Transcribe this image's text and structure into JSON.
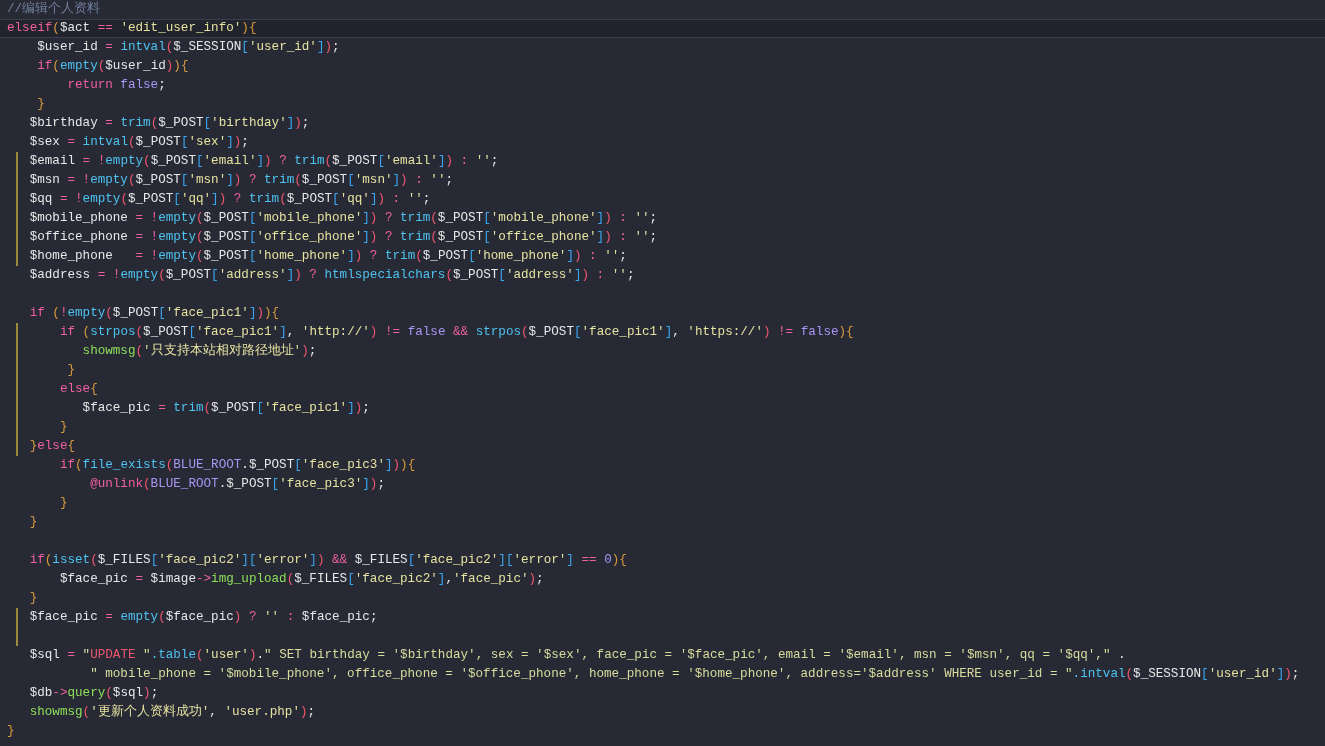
{
  "editor": {
    "lines": [
      {
        "kind": "code",
        "tokens": [
          {
            "kind": "comment",
            "text": "//编辑个人资料"
          }
        ]
      },
      {
        "kind": "code",
        "current": true,
        "tokens": [
          {
            "kind": "keyword",
            "text": "elseif"
          },
          {
            "kind": "brace",
            "text": "("
          },
          {
            "kind": "variable",
            "text": "$act"
          },
          {
            "kind": "operator",
            "text": " == "
          },
          {
            "kind": "string",
            "text": "'edit_user_info'"
          },
          {
            "kind": "brace",
            "text": ")"
          },
          {
            "kind": "brace",
            "text": "{"
          }
        ]
      },
      {
        "kind": "code",
        "tokens": [
          {
            "kind": "variable",
            "text": "    $user_id"
          },
          {
            "kind": "operator",
            "text": " = "
          },
          {
            "kind": "function",
            "text": "intval"
          },
          {
            "kind": "paren",
            "text": "("
          },
          {
            "kind": "variable",
            "text": "$_SESSION"
          },
          {
            "kind": "bracket",
            "text": "["
          },
          {
            "kind": "string",
            "text": "'user_id'"
          },
          {
            "kind": "bracket",
            "text": "]"
          },
          {
            "kind": "paren",
            "text": ")"
          },
          {
            "kind": "plain",
            "text": ";"
          }
        ]
      },
      {
        "kind": "code",
        "tokens": [
          {
            "kind": "keyword",
            "text": "    if"
          },
          {
            "kind": "brace",
            "text": "("
          },
          {
            "kind": "function",
            "text": "empty"
          },
          {
            "kind": "paren",
            "text": "("
          },
          {
            "kind": "variable",
            "text": "$user_id"
          },
          {
            "kind": "paren",
            "text": ")"
          },
          {
            "kind": "brace",
            "text": ")"
          },
          {
            "kind": "brace",
            "text": "{"
          }
        ]
      },
      {
        "kind": "code",
        "tokens": [
          {
            "kind": "keyword",
            "text": "        return"
          },
          {
            "kind": "constant",
            "text": " false"
          },
          {
            "kind": "plain",
            "text": ";"
          }
        ]
      },
      {
        "kind": "code",
        "tokens": [
          {
            "kind": "brace",
            "text": "    }"
          }
        ]
      },
      {
        "kind": "code",
        "tokens": [
          {
            "kind": "variable",
            "text": "   $birthday"
          },
          {
            "kind": "operator",
            "text": " = "
          },
          {
            "kind": "function",
            "text": "trim"
          },
          {
            "kind": "paren",
            "text": "("
          },
          {
            "kind": "variable",
            "text": "$_POST"
          },
          {
            "kind": "bracket",
            "text": "["
          },
          {
            "kind": "string",
            "text": "'birthday'"
          },
          {
            "kind": "bracket",
            "text": "]"
          },
          {
            "kind": "paren",
            "text": ")"
          },
          {
            "kind": "plain",
            "text": ";"
          }
        ]
      },
      {
        "kind": "code",
        "tokens": [
          {
            "kind": "variable",
            "text": "   $sex"
          },
          {
            "kind": "operator",
            "text": " = "
          },
          {
            "kind": "function",
            "text": "intval"
          },
          {
            "kind": "paren",
            "text": "("
          },
          {
            "kind": "variable",
            "text": "$_POST"
          },
          {
            "kind": "bracket",
            "text": "["
          },
          {
            "kind": "string",
            "text": "'sex'"
          },
          {
            "kind": "bracket",
            "text": "]"
          },
          {
            "kind": "paren",
            "text": ")"
          },
          {
            "kind": "plain",
            "text": ";"
          }
        ]
      },
      {
        "kind": "code",
        "modified": true,
        "tokens": [
          {
            "kind": "variable",
            "text": "   $email"
          },
          {
            "kind": "operator",
            "text": " = !"
          },
          {
            "kind": "function",
            "text": "empty"
          },
          {
            "kind": "paren",
            "text": "("
          },
          {
            "kind": "variable",
            "text": "$_POST"
          },
          {
            "kind": "bracket",
            "text": "["
          },
          {
            "kind": "string",
            "text": "'email'"
          },
          {
            "kind": "bracket",
            "text": "]"
          },
          {
            "kind": "paren",
            "text": ")"
          },
          {
            "kind": "operator",
            "text": " ? "
          },
          {
            "kind": "function",
            "text": "trim"
          },
          {
            "kind": "paren",
            "text": "("
          },
          {
            "kind": "variable",
            "text": "$_POST"
          },
          {
            "kind": "bracket",
            "text": "["
          },
          {
            "kind": "string",
            "text": "'email'"
          },
          {
            "kind": "bracket",
            "text": "]"
          },
          {
            "kind": "paren",
            "text": ")"
          },
          {
            "kind": "operator",
            "text": " : "
          },
          {
            "kind": "string",
            "text": "''"
          },
          {
            "kind": "plain",
            "text": ";"
          }
        ]
      },
      {
        "kind": "code",
        "modified": true,
        "tokens": [
          {
            "kind": "variable",
            "text": "   $msn"
          },
          {
            "kind": "operator",
            "text": " = !"
          },
          {
            "kind": "function",
            "text": "empty"
          },
          {
            "kind": "paren",
            "text": "("
          },
          {
            "kind": "variable",
            "text": "$_POST"
          },
          {
            "kind": "bracket",
            "text": "["
          },
          {
            "kind": "string",
            "text": "'msn'"
          },
          {
            "kind": "bracket",
            "text": "]"
          },
          {
            "kind": "paren",
            "text": ")"
          },
          {
            "kind": "operator",
            "text": " ? "
          },
          {
            "kind": "function",
            "text": "trim"
          },
          {
            "kind": "paren",
            "text": "("
          },
          {
            "kind": "variable",
            "text": "$_POST"
          },
          {
            "kind": "bracket",
            "text": "["
          },
          {
            "kind": "string",
            "text": "'msn'"
          },
          {
            "kind": "bracket",
            "text": "]"
          },
          {
            "kind": "paren",
            "text": ")"
          },
          {
            "kind": "operator",
            "text": " : "
          },
          {
            "kind": "string",
            "text": "''"
          },
          {
            "kind": "plain",
            "text": ";"
          }
        ]
      },
      {
        "kind": "code",
        "modified": true,
        "tokens": [
          {
            "kind": "variable",
            "text": "   $qq"
          },
          {
            "kind": "operator",
            "text": " = !"
          },
          {
            "kind": "function",
            "text": "empty"
          },
          {
            "kind": "paren",
            "text": "("
          },
          {
            "kind": "variable",
            "text": "$_POST"
          },
          {
            "kind": "bracket",
            "text": "["
          },
          {
            "kind": "string",
            "text": "'qq'"
          },
          {
            "kind": "bracket",
            "text": "]"
          },
          {
            "kind": "paren",
            "text": ")"
          },
          {
            "kind": "operator",
            "text": " ? "
          },
          {
            "kind": "function",
            "text": "trim"
          },
          {
            "kind": "paren",
            "text": "("
          },
          {
            "kind": "variable",
            "text": "$_POST"
          },
          {
            "kind": "bracket",
            "text": "["
          },
          {
            "kind": "string",
            "text": "'qq'"
          },
          {
            "kind": "bracket",
            "text": "]"
          },
          {
            "kind": "paren",
            "text": ")"
          },
          {
            "kind": "operator",
            "text": " : "
          },
          {
            "kind": "string",
            "text": "''"
          },
          {
            "kind": "plain",
            "text": ";"
          }
        ]
      },
      {
        "kind": "code",
        "modified": true,
        "tokens": [
          {
            "kind": "variable",
            "text": "   $mobile_phone"
          },
          {
            "kind": "operator",
            "text": " = !"
          },
          {
            "kind": "function",
            "text": "empty"
          },
          {
            "kind": "paren",
            "text": "("
          },
          {
            "kind": "variable",
            "text": "$_POST"
          },
          {
            "kind": "bracket",
            "text": "["
          },
          {
            "kind": "string",
            "text": "'mobile_phone'"
          },
          {
            "kind": "bracket",
            "text": "]"
          },
          {
            "kind": "paren",
            "text": ")"
          },
          {
            "kind": "operator",
            "text": " ? "
          },
          {
            "kind": "function",
            "text": "trim"
          },
          {
            "kind": "paren",
            "text": "("
          },
          {
            "kind": "variable",
            "text": "$_POST"
          },
          {
            "kind": "bracket",
            "text": "["
          },
          {
            "kind": "string",
            "text": "'mobile_phone'"
          },
          {
            "kind": "bracket",
            "text": "]"
          },
          {
            "kind": "paren",
            "text": ")"
          },
          {
            "kind": "operator",
            "text": " : "
          },
          {
            "kind": "string",
            "text": "''"
          },
          {
            "kind": "plain",
            "text": ";"
          }
        ]
      },
      {
        "kind": "code",
        "modified": true,
        "tokens": [
          {
            "kind": "variable",
            "text": "   $office_phone"
          },
          {
            "kind": "operator",
            "text": " = !"
          },
          {
            "kind": "function",
            "text": "empty"
          },
          {
            "kind": "paren",
            "text": "("
          },
          {
            "kind": "variable",
            "text": "$_POST"
          },
          {
            "kind": "bracket",
            "text": "["
          },
          {
            "kind": "string",
            "text": "'office_phone'"
          },
          {
            "kind": "bracket",
            "text": "]"
          },
          {
            "kind": "paren",
            "text": ")"
          },
          {
            "kind": "operator",
            "text": " ? "
          },
          {
            "kind": "function",
            "text": "trim"
          },
          {
            "kind": "paren",
            "text": "("
          },
          {
            "kind": "variable",
            "text": "$_POST"
          },
          {
            "kind": "bracket",
            "text": "["
          },
          {
            "kind": "string",
            "text": "'office_phone'"
          },
          {
            "kind": "bracket",
            "text": "]"
          },
          {
            "kind": "paren",
            "text": ")"
          },
          {
            "kind": "operator",
            "text": " : "
          },
          {
            "kind": "string",
            "text": "''"
          },
          {
            "kind": "plain",
            "text": ";"
          }
        ]
      },
      {
        "kind": "code",
        "modified": true,
        "tokens": [
          {
            "kind": "variable",
            "text": "   $home_phone"
          },
          {
            "kind": "operator",
            "text": "   = !"
          },
          {
            "kind": "function",
            "text": "empty"
          },
          {
            "kind": "paren",
            "text": "("
          },
          {
            "kind": "variable",
            "text": "$_POST"
          },
          {
            "kind": "bracket",
            "text": "["
          },
          {
            "kind": "string",
            "text": "'home_phone'"
          },
          {
            "kind": "bracket",
            "text": "]"
          },
          {
            "kind": "paren",
            "text": ")"
          },
          {
            "kind": "operator",
            "text": " ? "
          },
          {
            "kind": "function",
            "text": "trim"
          },
          {
            "kind": "paren",
            "text": "("
          },
          {
            "kind": "variable",
            "text": "$_POST"
          },
          {
            "kind": "bracket",
            "text": "["
          },
          {
            "kind": "string",
            "text": "'home_phone'"
          },
          {
            "kind": "bracket",
            "text": "]"
          },
          {
            "kind": "paren",
            "text": ")"
          },
          {
            "kind": "operator",
            "text": " : "
          },
          {
            "kind": "string",
            "text": "''"
          },
          {
            "kind": "plain",
            "text": ";"
          }
        ]
      },
      {
        "kind": "code",
        "tokens": [
          {
            "kind": "variable",
            "text": "   $address"
          },
          {
            "kind": "operator",
            "text": " = !"
          },
          {
            "kind": "function",
            "text": "empty"
          },
          {
            "kind": "paren",
            "text": "("
          },
          {
            "kind": "variable",
            "text": "$_POST"
          },
          {
            "kind": "bracket",
            "text": "["
          },
          {
            "kind": "string",
            "text": "'address'"
          },
          {
            "kind": "bracket",
            "text": "]"
          },
          {
            "kind": "paren",
            "text": ")"
          },
          {
            "kind": "operator",
            "text": " ? "
          },
          {
            "kind": "function",
            "text": "htmlspecialchars"
          },
          {
            "kind": "paren",
            "text": "("
          },
          {
            "kind": "variable",
            "text": "$_POST"
          },
          {
            "kind": "bracket",
            "text": "["
          },
          {
            "kind": "string",
            "text": "'address'"
          },
          {
            "kind": "bracket",
            "text": "]"
          },
          {
            "kind": "paren",
            "text": ")"
          },
          {
            "kind": "operator",
            "text": " : "
          },
          {
            "kind": "string",
            "text": "''"
          },
          {
            "kind": "plain",
            "text": ";"
          }
        ]
      },
      {
        "kind": "blank"
      },
      {
        "kind": "code",
        "tokens": [
          {
            "kind": "keyword",
            "text": "   if"
          },
          {
            "kind": "brace",
            "text": " ("
          },
          {
            "kind": "operator",
            "text": "!"
          },
          {
            "kind": "function",
            "text": "empty"
          },
          {
            "kind": "paren",
            "text": "("
          },
          {
            "kind": "variable",
            "text": "$_POST"
          },
          {
            "kind": "bracket",
            "text": "["
          },
          {
            "kind": "string",
            "text": "'face_pic1'"
          },
          {
            "kind": "bracket",
            "text": "]"
          },
          {
            "kind": "paren",
            "text": ")"
          },
          {
            "kind": "brace",
            "text": ")"
          },
          {
            "kind": "brace",
            "text": "{"
          }
        ]
      },
      {
        "kind": "code",
        "modified": true,
        "tokens": [
          {
            "kind": "keyword",
            "text": "       if"
          },
          {
            "kind": "brace",
            "text": " ("
          },
          {
            "kind": "function",
            "text": "strpos"
          },
          {
            "kind": "paren",
            "text": "("
          },
          {
            "kind": "variable",
            "text": "$_POST"
          },
          {
            "kind": "bracket",
            "text": "["
          },
          {
            "kind": "string",
            "text": "'face_pic1'"
          },
          {
            "kind": "bracket",
            "text": "]"
          },
          {
            "kind": "plain",
            "text": ", "
          },
          {
            "kind": "string",
            "text": "'http://'"
          },
          {
            "kind": "paren",
            "text": ")"
          },
          {
            "kind": "operator",
            "text": " != "
          },
          {
            "kind": "constant",
            "text": "false"
          },
          {
            "kind": "operator",
            "text": " && "
          },
          {
            "kind": "function",
            "text": "strpos"
          },
          {
            "kind": "paren",
            "text": "("
          },
          {
            "kind": "variable",
            "text": "$_POST"
          },
          {
            "kind": "bracket",
            "text": "["
          },
          {
            "kind": "string",
            "text": "'face_pic1'"
          },
          {
            "kind": "bracket",
            "text": "]"
          },
          {
            "kind": "plain",
            "text": ", "
          },
          {
            "kind": "string",
            "text": "'https://'"
          },
          {
            "kind": "paren",
            "text": ")"
          },
          {
            "kind": "operator",
            "text": " != "
          },
          {
            "kind": "constant",
            "text": "false"
          },
          {
            "kind": "brace",
            "text": ")"
          },
          {
            "kind": "brace",
            "text": "{"
          }
        ]
      },
      {
        "kind": "code",
        "modified": true,
        "tokens": [
          {
            "kind": "method",
            "text": "          showmsg"
          },
          {
            "kind": "paren",
            "text": "("
          },
          {
            "kind": "string",
            "text": "'只支持本站相对路径地址'"
          },
          {
            "kind": "paren",
            "text": ")"
          },
          {
            "kind": "plain",
            "text": ";"
          }
        ]
      },
      {
        "kind": "code",
        "modified": true,
        "tokens": [
          {
            "kind": "brace",
            "text": "        }"
          }
        ]
      },
      {
        "kind": "code",
        "modified": true,
        "tokens": [
          {
            "kind": "keyword",
            "text": "       else"
          },
          {
            "kind": "brace",
            "text": "{"
          }
        ]
      },
      {
        "kind": "code",
        "modified": true,
        "tokens": [
          {
            "kind": "variable",
            "text": "          $face_pic"
          },
          {
            "kind": "operator",
            "text": " = "
          },
          {
            "kind": "function",
            "text": "trim"
          },
          {
            "kind": "paren",
            "text": "("
          },
          {
            "kind": "variable",
            "text": "$_POST"
          },
          {
            "kind": "bracket",
            "text": "["
          },
          {
            "kind": "string",
            "text": "'face_pic1'"
          },
          {
            "kind": "bracket",
            "text": "]"
          },
          {
            "kind": "paren",
            "text": ")"
          },
          {
            "kind": "plain",
            "text": ";"
          }
        ]
      },
      {
        "kind": "code",
        "modified": true,
        "tokens": [
          {
            "kind": "brace",
            "text": "       }"
          }
        ]
      },
      {
        "kind": "code",
        "modified": true,
        "tokens": [
          {
            "kind": "brace",
            "text": "   }"
          },
          {
            "kind": "keyword",
            "text": "else"
          },
          {
            "kind": "brace",
            "text": "{"
          }
        ]
      },
      {
        "kind": "code",
        "tokens": [
          {
            "kind": "keyword",
            "text": "       if"
          },
          {
            "kind": "brace",
            "text": "("
          },
          {
            "kind": "function",
            "text": "file_exists"
          },
          {
            "kind": "paren",
            "text": "("
          },
          {
            "kind": "constant",
            "text": "BLUE_ROOT"
          },
          {
            "kind": "plain",
            "text": "."
          },
          {
            "kind": "variable",
            "text": "$_POST"
          },
          {
            "kind": "bracket",
            "text": "["
          },
          {
            "kind": "string",
            "text": "'face_pic3'"
          },
          {
            "kind": "bracket",
            "text": "]"
          },
          {
            "kind": "paren",
            "text": ")"
          },
          {
            "kind": "brace",
            "text": ")"
          },
          {
            "kind": "brace",
            "text": "{"
          }
        ]
      },
      {
        "kind": "code",
        "tokens": [
          {
            "kind": "keyword",
            "text": "           @unlink"
          },
          {
            "kind": "paren",
            "text": "("
          },
          {
            "kind": "constant",
            "text": "BLUE_ROOT"
          },
          {
            "kind": "plain",
            "text": "."
          },
          {
            "kind": "variable",
            "text": "$_POST"
          },
          {
            "kind": "bracket",
            "text": "["
          },
          {
            "kind": "string",
            "text": "'face_pic3'"
          },
          {
            "kind": "bracket",
            "text": "]"
          },
          {
            "kind": "paren",
            "text": ")"
          },
          {
            "kind": "plain",
            "text": ";"
          }
        ]
      },
      {
        "kind": "code",
        "tokens": [
          {
            "kind": "brace",
            "text": "       }"
          }
        ]
      },
      {
        "kind": "code",
        "tokens": [
          {
            "kind": "brace",
            "text": "   }"
          }
        ]
      },
      {
        "kind": "blank"
      },
      {
        "kind": "code",
        "tokens": [
          {
            "kind": "keyword",
            "text": "   if"
          },
          {
            "kind": "brace",
            "text": "("
          },
          {
            "kind": "function",
            "text": "isset"
          },
          {
            "kind": "paren",
            "text": "("
          },
          {
            "kind": "variable",
            "text": "$_FILES"
          },
          {
            "kind": "bracket",
            "text": "["
          },
          {
            "kind": "string",
            "text": "'face_pic2'"
          },
          {
            "kind": "bracket",
            "text": "]["
          },
          {
            "kind": "string",
            "text": "'error'"
          },
          {
            "kind": "bracket",
            "text": "]"
          },
          {
            "kind": "paren",
            "text": ")"
          },
          {
            "kind": "operator",
            "text": " && "
          },
          {
            "kind": "variable",
            "text": "$_FILES"
          },
          {
            "kind": "bracket",
            "text": "["
          },
          {
            "kind": "string",
            "text": "'face_pic2'"
          },
          {
            "kind": "bracket",
            "text": "]["
          },
          {
            "kind": "string",
            "text": "'error'"
          },
          {
            "kind": "bracket",
            "text": "]"
          },
          {
            "kind": "operator",
            "text": " == "
          },
          {
            "kind": "constant",
            "text": "0"
          },
          {
            "kind": "brace",
            "text": ")"
          },
          {
            "kind": "brace",
            "text": "{"
          }
        ]
      },
      {
        "kind": "code",
        "tokens": [
          {
            "kind": "variable",
            "text": "       $face_pic"
          },
          {
            "kind": "operator",
            "text": " = "
          },
          {
            "kind": "variable",
            "text": "$image"
          },
          {
            "kind": "operator",
            "text": "->"
          },
          {
            "kind": "method",
            "text": "img_upload"
          },
          {
            "kind": "paren",
            "text": "("
          },
          {
            "kind": "variable",
            "text": "$_FILES"
          },
          {
            "kind": "bracket",
            "text": "["
          },
          {
            "kind": "string",
            "text": "'face_pic2'"
          },
          {
            "kind": "bracket",
            "text": "]"
          },
          {
            "kind": "plain",
            "text": ","
          },
          {
            "kind": "string",
            "text": "'face_pic'"
          },
          {
            "kind": "paren",
            "text": ")"
          },
          {
            "kind": "plain",
            "text": ";"
          }
        ]
      },
      {
        "kind": "code",
        "tokens": [
          {
            "kind": "brace",
            "text": "   }"
          }
        ]
      },
      {
        "kind": "code",
        "modified": true,
        "tokens": [
          {
            "kind": "variable",
            "text": "   $face_pic"
          },
          {
            "kind": "operator",
            "text": " = "
          },
          {
            "kind": "function",
            "text": "empty"
          },
          {
            "kind": "paren",
            "text": "("
          },
          {
            "kind": "variable",
            "text": "$face_pic"
          },
          {
            "kind": "paren",
            "text": ")"
          },
          {
            "kind": "operator",
            "text": " ? "
          },
          {
            "kind": "string",
            "text": "''"
          },
          {
            "kind": "operator",
            "text": " : "
          },
          {
            "kind": "variable",
            "text": "$face_pic"
          },
          {
            "kind": "plain",
            "text": ";"
          }
        ]
      },
      {
        "kind": "blank",
        "modified": true
      },
      {
        "kind": "code",
        "tokens": [
          {
            "kind": "variable",
            "text": "   $sql"
          },
          {
            "kind": "operator",
            "text": " = "
          },
          {
            "kind": "dstring",
            "text": "\""
          },
          {
            "kind": "sqlword",
            "text": "UPDATE"
          },
          {
            "kind": "dstring",
            "text": " \""
          },
          {
            "kind": "function",
            "text": ".table"
          },
          {
            "kind": "paren",
            "text": "("
          },
          {
            "kind": "string",
            "text": "'user'"
          },
          {
            "kind": "paren",
            "text": ")"
          },
          {
            "kind": "plain",
            "text": "."
          },
          {
            "kind": "dstring",
            "text": "\" SET birthday = '$birthday', sex = '$sex', face_pic = '$face_pic', email = '$email', msn = '$msn', qq = '$qq',\""
          },
          {
            "kind": "plain",
            "text": " ."
          }
        ]
      },
      {
        "kind": "code",
        "tokens": [
          {
            "kind": "dstring",
            "text": "           \" mobile_phone = '$mobile_phone', office_phone = '$office_phone', home_phone = '$home_phone', address='$address' WHERE user_id = \""
          },
          {
            "kind": "function",
            "text": ".intval"
          },
          {
            "kind": "paren",
            "text": "("
          },
          {
            "kind": "variable",
            "text": "$_SESSION"
          },
          {
            "kind": "bracket",
            "text": "["
          },
          {
            "kind": "string",
            "text": "'user_id'"
          },
          {
            "kind": "bracket",
            "text": "]"
          },
          {
            "kind": "paren",
            "text": ")"
          },
          {
            "kind": "plain",
            "text": ";"
          }
        ]
      },
      {
        "kind": "code",
        "tokens": [
          {
            "kind": "variable",
            "text": "   $db"
          },
          {
            "kind": "operator",
            "text": "->"
          },
          {
            "kind": "method",
            "text": "query"
          },
          {
            "kind": "paren",
            "text": "("
          },
          {
            "kind": "variable",
            "text": "$sql"
          },
          {
            "kind": "paren",
            "text": ")"
          },
          {
            "kind": "plain",
            "text": ";"
          }
        ]
      },
      {
        "kind": "code",
        "tokens": [
          {
            "kind": "method",
            "text": "   showmsg"
          },
          {
            "kind": "paren",
            "text": "("
          },
          {
            "kind": "string",
            "text": "'更新个人资料成功'"
          },
          {
            "kind": "plain",
            "text": ", "
          },
          {
            "kind": "string",
            "text": "'user.php'"
          },
          {
            "kind": "paren",
            "text": ")"
          },
          {
            "kind": "plain",
            "text": ";"
          }
        ]
      },
      {
        "kind": "code",
        "tokens": [
          {
            "kind": "brace",
            "text": "}"
          }
        ]
      }
    ]
  }
}
